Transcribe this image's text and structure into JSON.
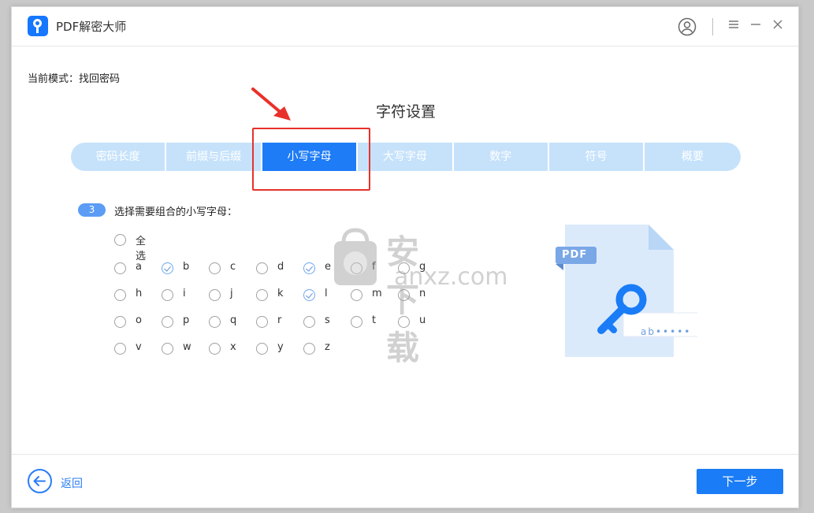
{
  "app": {
    "title": "PDF解密大师"
  },
  "mode": {
    "text": "当前模式：找回密码"
  },
  "section_title": "字符设置",
  "tabs": [
    {
      "label": "密码长度",
      "active": false
    },
    {
      "label": "前缀与后缀",
      "active": false
    },
    {
      "label": "小写字母",
      "active": true
    },
    {
      "label": "大写字母",
      "active": false
    },
    {
      "label": "数字",
      "active": false
    },
    {
      "label": "符号",
      "active": false
    },
    {
      "label": "概要",
      "active": false
    }
  ],
  "step": {
    "number": "3",
    "text": "选择需要组合的小写字母："
  },
  "select_all": {
    "label": "全选",
    "checked": false
  },
  "letters": [
    {
      "label": "a",
      "checked": false
    },
    {
      "label": "b",
      "checked": true
    },
    {
      "label": "c",
      "checked": false
    },
    {
      "label": "d",
      "checked": false
    },
    {
      "label": "e",
      "checked": true
    },
    {
      "label": "f",
      "checked": false
    },
    {
      "label": "g",
      "checked": false
    },
    {
      "label": "h",
      "checked": false
    },
    {
      "label": "i",
      "checked": false
    },
    {
      "label": "j",
      "checked": false
    },
    {
      "label": "k",
      "checked": false
    },
    {
      "label": "l",
      "checked": true
    },
    {
      "label": "m",
      "checked": false
    },
    {
      "label": "n",
      "checked": false
    },
    {
      "label": "o",
      "checked": false
    },
    {
      "label": "p",
      "checked": false
    },
    {
      "label": "q",
      "checked": false
    },
    {
      "label": "r",
      "checked": false
    },
    {
      "label": "s",
      "checked": false
    },
    {
      "label": "t",
      "checked": false
    },
    {
      "label": "u",
      "checked": false
    },
    {
      "label": "v",
      "checked": false
    },
    {
      "label": "w",
      "checked": false
    },
    {
      "label": "x",
      "checked": false
    },
    {
      "label": "y",
      "checked": false
    },
    {
      "label": "z",
      "checked": false
    }
  ],
  "illustration": {
    "badge": "PDF",
    "password_hint": "ab•••••"
  },
  "watermark": {
    "text": "安下载",
    "sub": "anxz.com"
  },
  "footer": {
    "back_label": "返回",
    "next_label": "下一步"
  },
  "colors": {
    "accent": "#1e7cf7",
    "tab_inactive": "#c6e2fb",
    "highlight": "#e8312a"
  },
  "icons": {
    "user": "user-icon",
    "menu": "menu-icon",
    "minimize": "minimize-icon",
    "close": "close-icon",
    "back": "arrow-left-icon"
  }
}
